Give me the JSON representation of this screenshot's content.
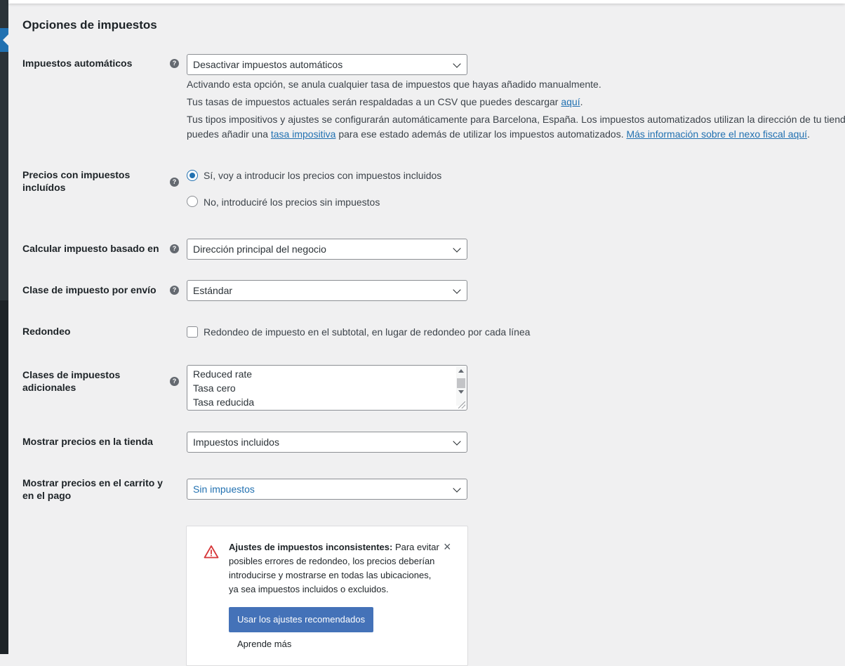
{
  "section": {
    "title": "Opciones de impuestos"
  },
  "rows": {
    "auto_tax": {
      "label": "Impuestos automáticos",
      "value": "Desactivar impuestos automáticos",
      "desc1": "Activando esta opción, se anula cualquier tasa de impuestos que hayas añadido manualmente.",
      "desc2_text": "Tus tasas de impuestos actuales serán respaldadas a un CSV que puedes descargar ",
      "desc2_link": "aquí",
      "desc2_end": ".",
      "desc3": "Tus tipos impositivos y ajustes se configurarán automáticamente para Barcelona, España. Los impuestos automatizados utilizan la dirección de tu tienda",
      "desc4_a": "puedes añadir una ",
      "desc4_link1": "tasa impositiva",
      "desc4_b": " para ese estado además de utilizar los impuestos automatizados. ",
      "desc4_link2": "Más información sobre el nexo fiscal aquí",
      "desc4_end": "."
    },
    "prices_incl": {
      "label_line1": "Precios con impuestos",
      "label_line2": "incluídos",
      "option_yes": "Sí, voy a introducir los precios con impuestos incluidos",
      "option_no": "No, introduciré los precios sin impuestos",
      "selected": "option_yes"
    },
    "calc_based": {
      "label": "Calcular impuesto basado en",
      "value": "Dirección principal del negocio"
    },
    "shipping_class": {
      "label": "Clase de impuesto por envío",
      "value": "Estándar"
    },
    "rounding": {
      "label": "Redondeo",
      "checkbox_label": "Redondeo de impuesto en el subtotal, en lugar de redondeo por cada línea",
      "checked": false
    },
    "additional_classes": {
      "label_line1": "Clases de impuestos",
      "label_line2": "adicionales",
      "lines": [
        "Reduced rate",
        "Tasa cero",
        "Tasa reducida"
      ]
    },
    "display_shop": {
      "label": "Mostrar precios en la tienda",
      "value": "Impuestos incluidos"
    },
    "display_cart": {
      "label_line1": "Mostrar precios en el carrito y",
      "label_line2": "en el pago",
      "value": "Sin impuestos"
    }
  },
  "notice": {
    "bold": "Ajustes de impuestos inconsistentes:",
    "line1_rest": " Para evitar",
    "line2": "posibles errores de redondeo, los precios deberían",
    "line3": "introducirse y mostrarse en todas las ubicaciones,",
    "line4": "ya sea impuestos incluidos o excluidos.",
    "primary_button": "Usar los ajustes recomendados",
    "learn_more": "Aprende más",
    "close_glyph": "×"
  },
  "help_glyph": "?",
  "colors": {
    "accent": "#2271b1",
    "button": "#4472b8",
    "warning": "#d63638",
    "sidebar": "#1d2327"
  },
  "icons": [
    "help-icon",
    "chevron-down-icon",
    "warning-triangle-icon",
    "close-icon"
  ]
}
